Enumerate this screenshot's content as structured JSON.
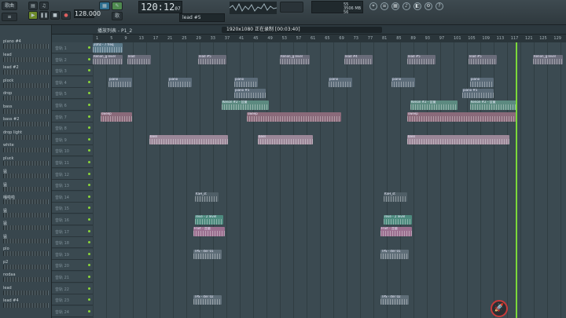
{
  "toolbar": {
    "mode_label": "歌曲",
    "time": "120:12",
    "time_sub": "07",
    "tempo": "128.000",
    "pattern_label": "歌",
    "hint": "lead #5",
    "cpu_line1": "55",
    "cpu_line2": "3506 MB",
    "cpu_line3": "56"
  },
  "browser": {
    "channels": [
      "piano #4",
      "lead",
      "lead #2",
      "plock",
      "drop",
      "bass",
      "bass #2",
      "drop light",
      "white",
      "pluck",
      "猛",
      "猛",
      "嘎啦啦",
      "猛",
      "猛",
      "猛",
      "plo",
      "p2",
      "nodaa",
      "lead",
      "lead #4"
    ]
  },
  "playlist": {
    "title": "播放列表 - P1_2",
    "record_text": "1920x1080 正在录制 [00:03:40]",
    "ruler": [
      "1",
      "5",
      "9",
      "13",
      "17",
      "21",
      "25",
      "29",
      "33",
      "37",
      "41",
      "45",
      "49",
      "53",
      "57",
      "61",
      "65",
      "69",
      "73",
      "77",
      "81",
      "85",
      "89",
      "93",
      "97",
      "101",
      "105",
      "109",
      "113",
      "117",
      "121",
      "125",
      "129"
    ],
    "track_label_prefix": "音轨",
    "tracks": [
      "1",
      "2",
      "3",
      "4",
      "5",
      "6",
      "7",
      "8",
      "9",
      "10",
      "11",
      "12",
      "13",
      "14",
      "15",
      "16",
      "17",
      "18",
      "19",
      "20",
      "21",
      "22",
      "23",
      "24"
    ],
    "clips": [
      {
        "name": "20hz - 7 freq",
        "track": 0,
        "start": 0,
        "len": 38,
        "color": "#5b7a8a"
      },
      {
        "name": "Renon_g level",
        "track": 1,
        "start": 0,
        "len": 38,
        "color": "#6a6c7a"
      },
      {
        "name": "lead",
        "track": 1,
        "start": 44,
        "len": 30,
        "color": "#6a6c7a"
      },
      {
        "name": "lead #5",
        "track": 1,
        "start": 134,
        "len": 36,
        "color": "#6a6c7a"
      },
      {
        "name": "Renon_g level",
        "track": 1,
        "start": 238,
        "len": 38,
        "color": "#6a6c7a"
      },
      {
        "name": "lead #4",
        "track": 1,
        "start": 320,
        "len": 36,
        "color": "#6a6c7a"
      },
      {
        "name": "lead #5",
        "track": 1,
        "start": 400,
        "len": 36,
        "color": "#6a6c7a"
      },
      {
        "name": "lead #5",
        "track": 1,
        "start": 478,
        "len": 36,
        "color": "#6a6c7a"
      },
      {
        "name": "Renon_g level",
        "track": 1,
        "start": 560,
        "len": 38,
        "color": "#6a6c7a"
      },
      {
        "name": "piano",
        "track": 3,
        "start": 20,
        "len": 30,
        "color": "#5b6b78"
      },
      {
        "name": "piano",
        "track": 3,
        "start": 96,
        "len": 30,
        "color": "#5b6b78"
      },
      {
        "name": "piano",
        "track": 3,
        "start": 180,
        "len": 30,
        "color": "#5b6b78"
      },
      {
        "name": "piano",
        "track": 3,
        "start": 300,
        "len": 30,
        "color": "#5b6b78"
      },
      {
        "name": "piano",
        "track": 3,
        "start": 380,
        "len": 30,
        "color": "#5b6b78"
      },
      {
        "name": "piano",
        "track": 3,
        "start": 480,
        "len": 30,
        "color": "#5b6b78"
      },
      {
        "name": "piano #5",
        "track": 4,
        "start": 180,
        "len": 40,
        "color": "#5b6b78"
      },
      {
        "name": "piano #5",
        "track": 4,
        "start": 470,
        "len": 40,
        "color": "#5b6b78"
      },
      {
        "name": "Kenon #2 - 音量",
        "track": 5,
        "start": 164,
        "len": 60,
        "color": "#5c8a80"
      },
      {
        "name": "Kenon #2 - 音量",
        "track": 5,
        "start": 404,
        "len": 60,
        "color": "#5c8a80"
      },
      {
        "name": "Kenon #2 - 音量",
        "track": 5,
        "start": 480,
        "len": 60,
        "color": "#5c8a80"
      },
      {
        "name": "sweep",
        "track": 6,
        "start": 10,
        "len": 40,
        "color": "#8a6a7a"
      },
      {
        "name": "sweep",
        "track": 6,
        "start": 196,
        "len": 120,
        "color": "#8a6a7a"
      },
      {
        "name": "sweep",
        "track": 6,
        "start": 400,
        "len": 140,
        "color": "#8a6a7a"
      },
      {
        "name": "bass",
        "track": 8,
        "start": 72,
        "len": 100,
        "color": "#9b8798"
      },
      {
        "name": "bass",
        "track": 8,
        "start": 210,
        "len": 70,
        "color": "#9b8798"
      },
      {
        "name": "bass",
        "track": 8,
        "start": 400,
        "len": 130,
        "color": "#9b8798"
      },
      {
        "name": "KSH_st",
        "track": 13,
        "start": 130,
        "len": 30,
        "color": "#4f5e66"
      },
      {
        "name": "KSH_st",
        "track": 13,
        "start": 370,
        "len": 30,
        "color": "#4f5e66"
      },
      {
        "name": "reve - 2 level",
        "track": 15,
        "start": 130,
        "len": 36,
        "color": "#4d8a7e"
      },
      {
        "name": "reve - 2 level",
        "track": 15,
        "start": 370,
        "len": 36,
        "color": "#4d8a7e"
      },
      {
        "name": "Fruit - 音量",
        "track": 16,
        "start": 128,
        "len": 40,
        "color": "#9a6f8f"
      },
      {
        "name": "Fruit - 音量",
        "track": 16,
        "start": 366,
        "len": 40,
        "color": "#9a6f8f"
      },
      {
        "name": "TPS - iter 01",
        "track": 18,
        "start": 128,
        "len": 36,
        "color": "#5f6e78"
      },
      {
        "name": "TPS - iter 01",
        "track": 18,
        "start": 366,
        "len": 36,
        "color": "#5f6e78"
      },
      {
        "name": "TPS - iter 02",
        "track": 22,
        "start": 128,
        "len": 36,
        "color": "#5f6e78"
      },
      {
        "name": "TPS - iter 02",
        "track": 22,
        "start": 366,
        "len": 36,
        "color": "#5f6e78"
      }
    ]
  }
}
